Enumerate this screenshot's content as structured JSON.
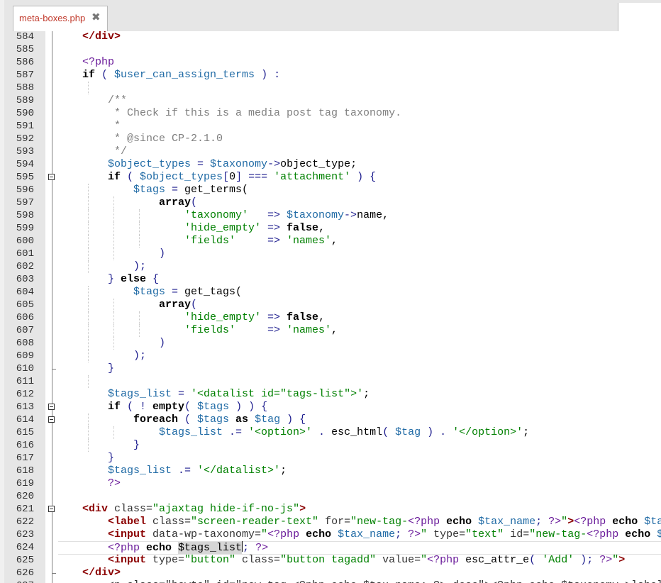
{
  "tab": {
    "filename": "meta-boxes.php",
    "close_glyph": "✖"
  },
  "colors": {
    "keyword": "#000000",
    "variable": "#1f6aa5",
    "string": "#008000",
    "comment": "#808080",
    "tag": "#8b0000",
    "php_tag": "#6a1b9a",
    "tab_text": "#c0392b"
  },
  "lines": [
    {
      "n": "584",
      "indent": 0,
      "tokens": [
        [
          "tg",
          "</div>"
        ]
      ]
    },
    {
      "n": "585",
      "indent": 0,
      "tokens": []
    },
    {
      "n": "586",
      "indent": 0,
      "tokens": [
        [
          "ph",
          "<?php"
        ]
      ]
    },
    {
      "n": "587",
      "indent": 0,
      "tokens": [
        [
          "k",
          "if"
        ],
        [
          "op",
          " ( "
        ],
        [
          "v",
          "$user_can_assign_terms"
        ],
        [
          "op",
          " ) :"
        ]
      ]
    },
    {
      "n": "588",
      "indent": 1,
      "tokens": []
    },
    {
      "n": "589",
      "indent": 1,
      "tokens": [
        [
          "c",
          "/**"
        ]
      ]
    },
    {
      "n": "590",
      "indent": 1,
      "tokens": [
        [
          "c",
          " * Check if this is a media post tag taxonomy."
        ]
      ]
    },
    {
      "n": "591",
      "indent": 1,
      "tokens": [
        [
          "c",
          " *"
        ]
      ]
    },
    {
      "n": "592",
      "indent": 1,
      "tokens": [
        [
          "c",
          " * @since CP-2.1.0"
        ]
      ]
    },
    {
      "n": "593",
      "indent": 1,
      "tokens": [
        [
          "c",
          " */"
        ]
      ]
    },
    {
      "n": "594",
      "indent": 1,
      "tokens": [
        [
          "v",
          "$object_types"
        ],
        [
          "op",
          " = "
        ],
        [
          "v",
          "$taxonomy"
        ],
        [
          "op",
          "->"
        ],
        [
          "pl",
          "object_type;"
        ]
      ]
    },
    {
      "n": "595",
      "indent": 1,
      "fold": "open",
      "tokens": [
        [
          "k",
          "if"
        ],
        [
          "op",
          " ( "
        ],
        [
          "v",
          "$object_types"
        ],
        [
          "op",
          "["
        ],
        [
          "pl",
          "0"
        ],
        [
          "op",
          "] === "
        ],
        [
          "s",
          "'attachment'"
        ],
        [
          "op",
          " ) {"
        ]
      ]
    },
    {
      "n": "596",
      "indent": 2,
      "tokens": [
        [
          "v",
          "$tags"
        ],
        [
          "op",
          " = "
        ],
        [
          "pl",
          "get_terms("
        ]
      ]
    },
    {
      "n": "597",
      "indent": 3,
      "tokens": [
        [
          "k",
          "array"
        ],
        [
          "op",
          "("
        ]
      ]
    },
    {
      "n": "598",
      "indent": 4,
      "tokens": [
        [
          "s",
          "'taxonomy'"
        ],
        [
          "op",
          "   => "
        ],
        [
          "v",
          "$taxonomy"
        ],
        [
          "op",
          "->"
        ],
        [
          "pl",
          "name,"
        ]
      ]
    },
    {
      "n": "599",
      "indent": 4,
      "tokens": [
        [
          "s",
          "'hide_empty'"
        ],
        [
          "op",
          " => "
        ],
        [
          "k",
          "false"
        ],
        [
          "pl",
          ","
        ]
      ]
    },
    {
      "n": "600",
      "indent": 4,
      "tokens": [
        [
          "s",
          "'fields'"
        ],
        [
          "op",
          "     => "
        ],
        [
          "s",
          "'names'"
        ],
        [
          "pl",
          ","
        ]
      ]
    },
    {
      "n": "601",
      "indent": 3,
      "tokens": [
        [
          "op",
          ")"
        ]
      ]
    },
    {
      "n": "602",
      "indent": 2,
      "tokens": [
        [
          "op",
          ");"
        ]
      ]
    },
    {
      "n": "603",
      "indent": 1,
      "tokens": [
        [
          "op",
          "} "
        ],
        [
          "k",
          "else"
        ],
        [
          "op",
          " {"
        ]
      ]
    },
    {
      "n": "604",
      "indent": 2,
      "tokens": [
        [
          "v",
          "$tags"
        ],
        [
          "op",
          " = "
        ],
        [
          "pl",
          "get_tags("
        ]
      ]
    },
    {
      "n": "605",
      "indent": 3,
      "tokens": [
        [
          "k",
          "array"
        ],
        [
          "op",
          "("
        ]
      ]
    },
    {
      "n": "606",
      "indent": 4,
      "tokens": [
        [
          "s",
          "'hide_empty'"
        ],
        [
          "op",
          " => "
        ],
        [
          "k",
          "false"
        ],
        [
          "pl",
          ","
        ]
      ]
    },
    {
      "n": "607",
      "indent": 4,
      "tokens": [
        [
          "s",
          "'fields'"
        ],
        [
          "op",
          "     => "
        ],
        [
          "s",
          "'names'"
        ],
        [
          "pl",
          ","
        ]
      ]
    },
    {
      "n": "608",
      "indent": 3,
      "tokens": [
        [
          "op",
          ")"
        ]
      ]
    },
    {
      "n": "609",
      "indent": 2,
      "tokens": [
        [
          "op",
          ");"
        ]
      ]
    },
    {
      "n": "610",
      "indent": 1,
      "fold": "end",
      "tokens": [
        [
          "op",
          "}"
        ]
      ]
    },
    {
      "n": "611",
      "indent": 1,
      "tokens": []
    },
    {
      "n": "612",
      "indent": 1,
      "tokens": [
        [
          "v",
          "$tags_list"
        ],
        [
          "op",
          " = "
        ],
        [
          "s",
          "'<datalist id=\"tags-list\">'"
        ],
        [
          "pl",
          ";"
        ]
      ]
    },
    {
      "n": "613",
      "indent": 1,
      "fold": "open",
      "tokens": [
        [
          "k",
          "if"
        ],
        [
          "op",
          " ( ! "
        ],
        [
          "k",
          "empty"
        ],
        [
          "op",
          "( "
        ],
        [
          "v",
          "$tags"
        ],
        [
          "op",
          " ) ) {"
        ]
      ]
    },
    {
      "n": "614",
      "indent": 2,
      "fold": "open",
      "tokens": [
        [
          "k",
          "foreach"
        ],
        [
          "op",
          " ( "
        ],
        [
          "v",
          "$tags"
        ],
        [
          "k",
          " as "
        ],
        [
          "v",
          "$tag"
        ],
        [
          "op",
          " ) {"
        ]
      ]
    },
    {
      "n": "615",
      "indent": 3,
      "tokens": [
        [
          "v",
          "$tags_list"
        ],
        [
          "op",
          " .= "
        ],
        [
          "s",
          "'<option>'"
        ],
        [
          "op",
          " . "
        ],
        [
          "pl",
          "esc_html"
        ],
        [
          "op",
          "( "
        ],
        [
          "v",
          "$tag"
        ],
        [
          "op",
          " ) . "
        ],
        [
          "s",
          "'</option>'"
        ],
        [
          "pl",
          ";"
        ]
      ]
    },
    {
      "n": "616",
      "indent": 2,
      "tokens": [
        [
          "op",
          "}"
        ]
      ]
    },
    {
      "n": "617",
      "indent": 1,
      "tokens": [
        [
          "op",
          "}"
        ]
      ]
    },
    {
      "n": "618",
      "indent": 1,
      "tokens": [
        [
          "v",
          "$tags_list"
        ],
        [
          "op",
          " .= "
        ],
        [
          "s",
          "'</datalist>'"
        ],
        [
          "pl",
          ";"
        ]
      ]
    },
    {
      "n": "619",
      "indent": 1,
      "tokens": [
        [
          "ph",
          "?>"
        ]
      ]
    },
    {
      "n": "620",
      "indent": 0,
      "tokens": []
    },
    {
      "n": "621",
      "indent": 0,
      "fold": "open",
      "tokens": [
        [
          "tg",
          "<div"
        ],
        [
          "at",
          " class="
        ],
        [
          "s",
          "\"ajaxtag hide-if-no-js\""
        ],
        [
          "tg",
          ">"
        ]
      ]
    },
    {
      "n": "622",
      "indent": 1,
      "tokens": [
        [
          "tg",
          "<label"
        ],
        [
          "at",
          " class="
        ],
        [
          "s",
          "\"screen-reader-text\""
        ],
        [
          "at",
          " for="
        ],
        [
          "s",
          "\"new-tag-"
        ],
        [
          "ph",
          "<?php"
        ],
        [
          "k",
          " echo "
        ],
        [
          "v",
          "$tax_name"
        ],
        [
          "op",
          "; "
        ],
        [
          "ph",
          "?>"
        ],
        [
          "s",
          "\""
        ],
        [
          "tg",
          ">"
        ],
        [
          "ph",
          "<?php"
        ],
        [
          "k",
          " echo "
        ],
        [
          "v",
          "$tax"
        ]
      ]
    },
    {
      "n": "623",
      "indent": 1,
      "tokens": [
        [
          "tg",
          "<input"
        ],
        [
          "at",
          " data-wp-taxonomy="
        ],
        [
          "s",
          "\""
        ],
        [
          "ph",
          "<?php"
        ],
        [
          "k",
          " echo "
        ],
        [
          "v",
          "$tax_name"
        ],
        [
          "op",
          "; "
        ],
        [
          "ph",
          "?>"
        ],
        [
          "s",
          "\""
        ],
        [
          "at",
          " type="
        ],
        [
          "s",
          "\"text\""
        ],
        [
          "at",
          " id="
        ],
        [
          "s",
          "\"new-tag-"
        ],
        [
          "ph",
          "<?php"
        ],
        [
          "k",
          " echo "
        ],
        [
          "v",
          "$"
        ]
      ]
    },
    {
      "n": "624",
      "indent": 1,
      "current": true,
      "tokens": [
        [
          "ph",
          "<?php"
        ],
        [
          "k",
          " echo "
        ],
        [
          "sel",
          "$tags_list"
        ],
        [
          "caret",
          ""
        ],
        [
          "op",
          "; "
        ],
        [
          "ph",
          "?>"
        ]
      ]
    },
    {
      "n": "625",
      "indent": 1,
      "tokens": [
        [
          "tg",
          "<input"
        ],
        [
          "at",
          " type="
        ],
        [
          "s",
          "\"button\""
        ],
        [
          "at",
          " class="
        ],
        [
          "s",
          "\"button tagadd\""
        ],
        [
          "at",
          " value="
        ],
        [
          "s",
          "\""
        ],
        [
          "ph",
          "<?php"
        ],
        [
          "pl",
          " esc_attr_e"
        ],
        [
          "op",
          "( "
        ],
        [
          "s",
          "'Add'"
        ],
        [
          "op",
          " ); "
        ],
        [
          "ph",
          "?>"
        ],
        [
          "s",
          "\""
        ],
        [
          "tg",
          ">"
        ]
      ]
    },
    {
      "n": "626",
      "indent": 0,
      "fold": "end",
      "tokens": [
        [
          "tg",
          "</div>"
        ]
      ]
    },
    {
      "n": "627",
      "indent": 1,
      "tokens": [
        [
          "at",
          "<p class=\"howto\" id=\"new-tag-<?php echo $tax_name; ?>-desc\"><?php echo $taxonomy->labels"
        ]
      ]
    }
  ]
}
